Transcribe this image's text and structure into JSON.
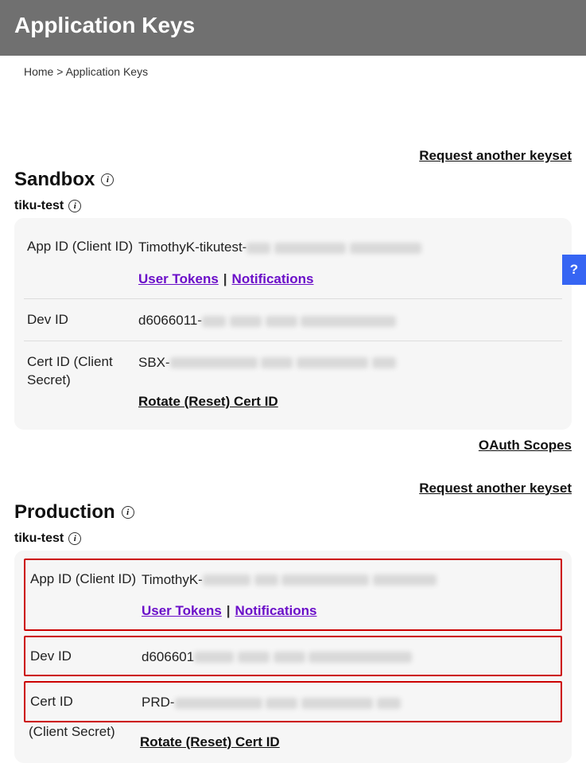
{
  "header": {
    "title": "Application Keys"
  },
  "breadcrumb": {
    "home": "Home",
    "sep": ">",
    "current": "Application Keys"
  },
  "actions": {
    "requestKeyset": "Request another keyset",
    "oauthScopes": "OAuth Scopes"
  },
  "sandbox": {
    "title": "Sandbox",
    "appName": "tiku-test",
    "rows": {
      "appId": {
        "label": "App ID (Client ID)",
        "prefix": "TimothyK-tikutest-",
        "userTokens": "User Tokens",
        "notifications": "Notifications"
      },
      "devId": {
        "label": "Dev ID",
        "prefix": "d6066011-"
      },
      "certId": {
        "label": "Cert ID (Client Secret)",
        "prefix": "SBX-",
        "rotate": "Rotate (Reset) Cert ID"
      }
    }
  },
  "production": {
    "title": "Production",
    "appName": "tiku-test",
    "rows": {
      "appId": {
        "label": "App ID (Client ID)",
        "prefix": "TimothyK-",
        "userTokens": "User Tokens",
        "notifications": "Notifications"
      },
      "devId": {
        "label": "Dev ID",
        "prefix": "d606601"
      },
      "certId": {
        "label": "Cert ID (Client Secret)",
        "prefix": "PRD-",
        "rotate": "Rotate (Reset) Cert ID"
      }
    }
  },
  "help": {
    "label": "?"
  }
}
